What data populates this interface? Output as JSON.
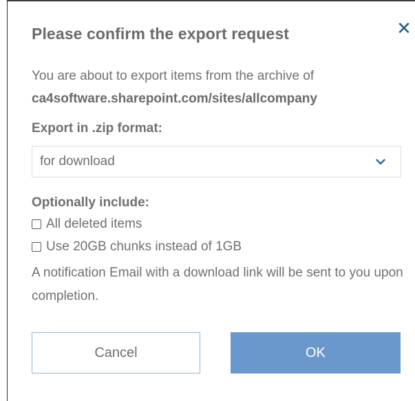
{
  "dialog": {
    "title": "Please confirm the export request",
    "close_icon": "close-icon",
    "intro": "You are about to export items from the archive of",
    "site": "ca4software.sharepoint.com/sites/allcompany",
    "format_label": "Export in .zip format:",
    "format_value": "for download",
    "optional_label": "Optionally include:",
    "options": [
      {
        "label": "All deleted items",
        "checked": false
      },
      {
        "label": "Use 20GB chunks instead of 1GB",
        "checked": false
      }
    ],
    "note": "A notification Email with a download link will be sent to you upon completion.",
    "cancel_label": "Cancel",
    "ok_label": "OK"
  },
  "colors": {
    "accent": "#6b98cc",
    "close": "#1f5d8f",
    "text": "#707070"
  }
}
